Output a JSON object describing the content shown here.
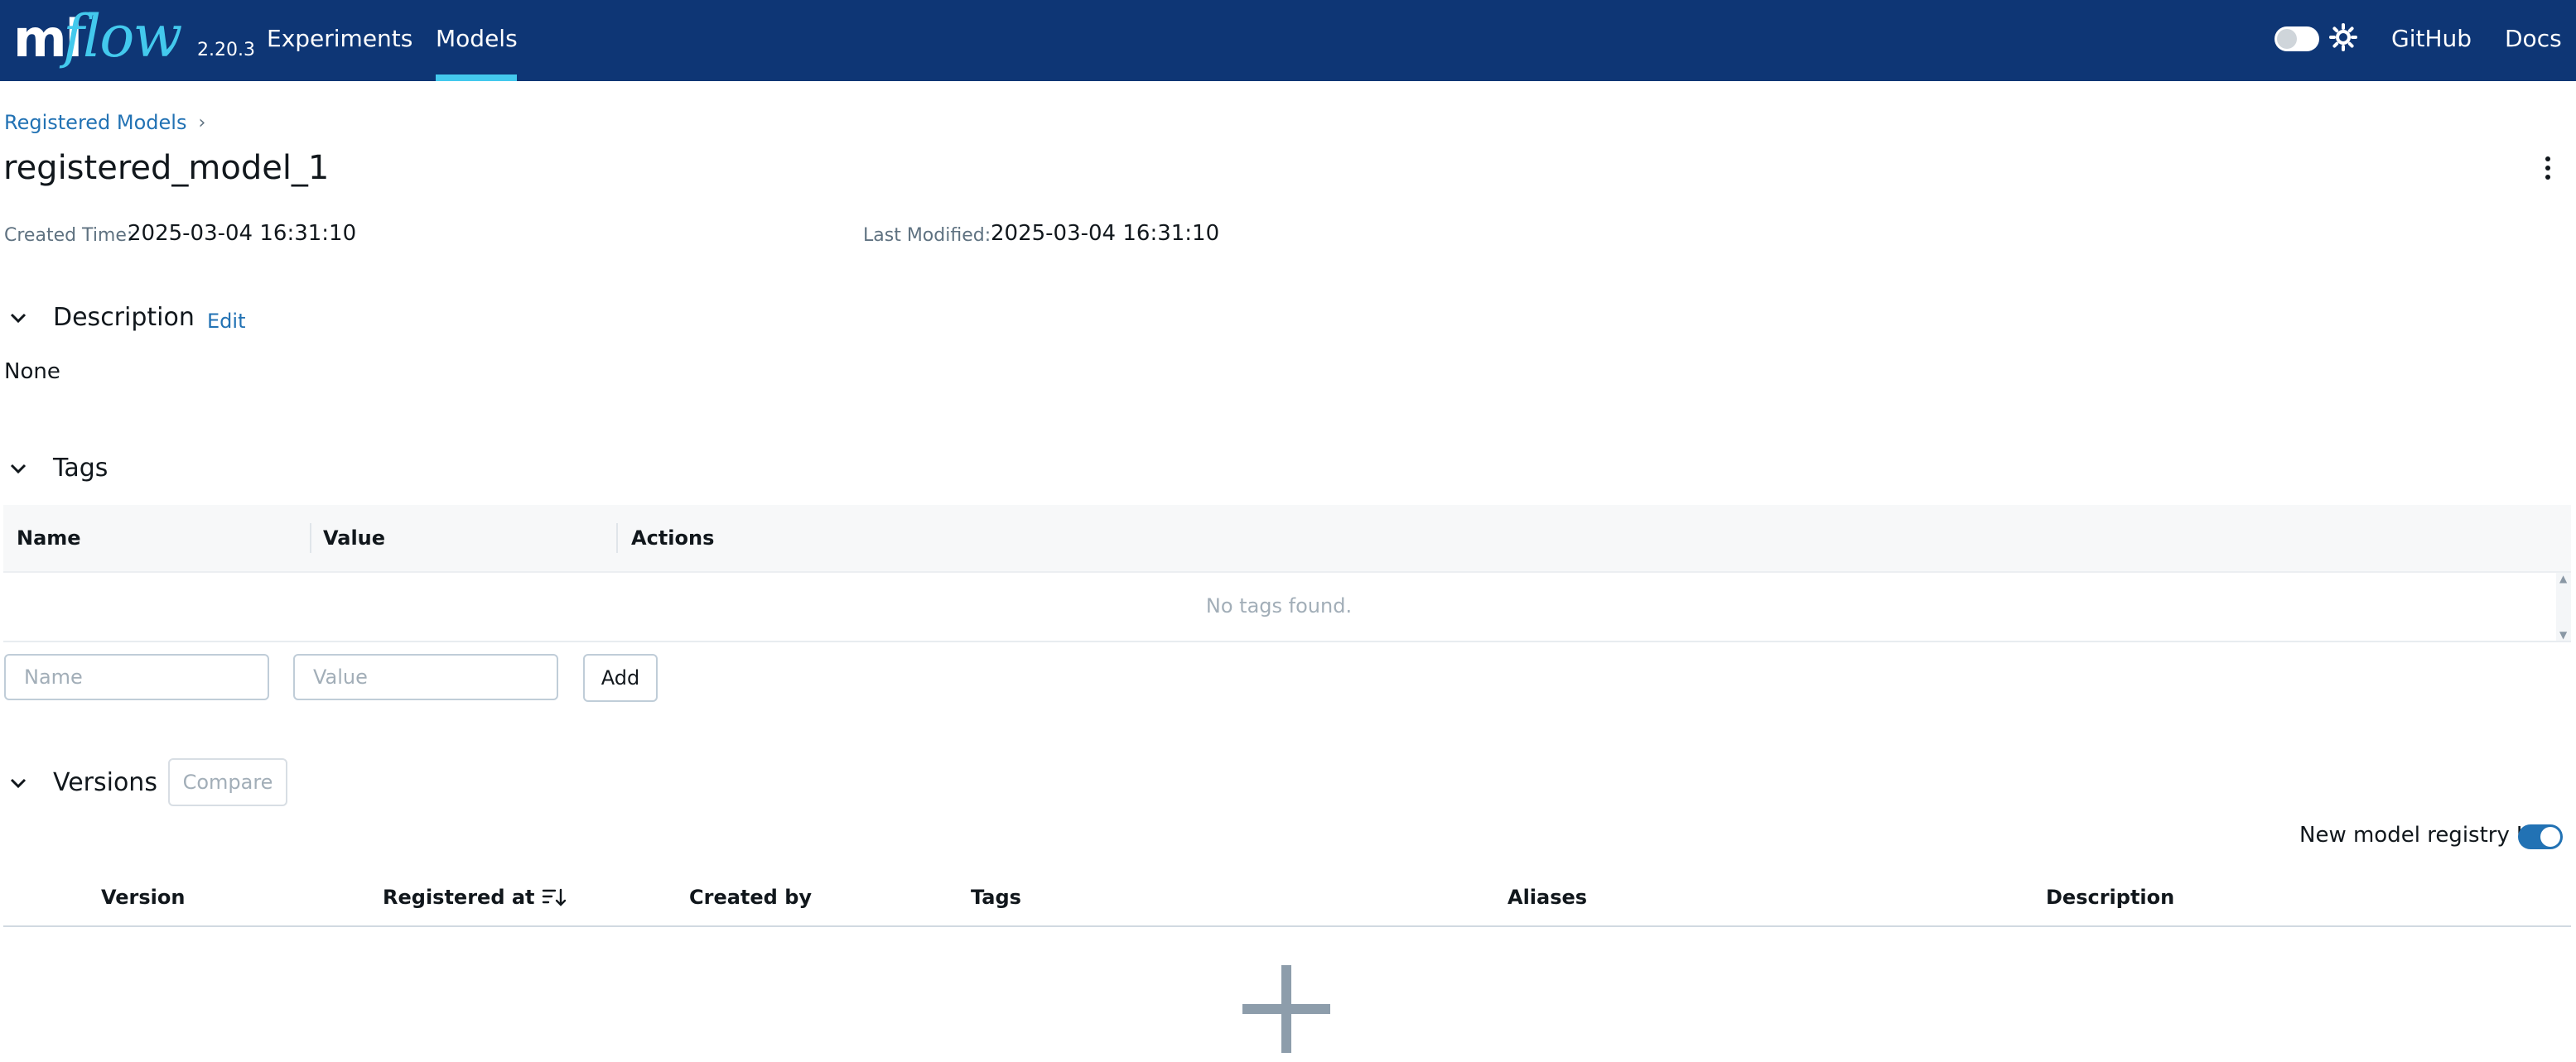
{
  "nav": {
    "logo_ml": "ml",
    "logo_flow": "flow",
    "version": "2.20.3",
    "experiments": "Experiments",
    "models": "Models",
    "github": "GitHub",
    "docs": "Docs",
    "active_tab": "Models"
  },
  "breadcrumb": {
    "item": "Registered Models"
  },
  "model": {
    "title": "registered_model_1",
    "created_label": "Created Time:",
    "created_value": "2025-03-04 16:31:10",
    "modified_label": "Last Modified:",
    "modified_value": "2025-03-04 16:31:10"
  },
  "description": {
    "title": "Description",
    "edit": "Edit",
    "value": "None"
  },
  "tags": {
    "title": "Tags",
    "columns": [
      "Name",
      "Value",
      "Actions"
    ],
    "empty": "No tags found.",
    "name_placeholder": "Name",
    "value_placeholder": "Value",
    "add": "Add"
  },
  "versions": {
    "title": "Versions",
    "compare": "Compare",
    "toggle_label": "New model registry UI",
    "toggle_on": true,
    "columns": [
      "Version",
      "Registered at",
      "Created by",
      "Tags",
      "Aliases",
      "Description"
    ]
  },
  "colors": {
    "nav_bg": "#0e3675",
    "accent": "#43c9ed",
    "link": "#2272b4"
  },
  "icons": {
    "theme": "sun-icon",
    "menu": "kebab-icon",
    "sort": "sort-descending-icon",
    "section": "chevron-down-icon",
    "empty": "plus-icon"
  }
}
